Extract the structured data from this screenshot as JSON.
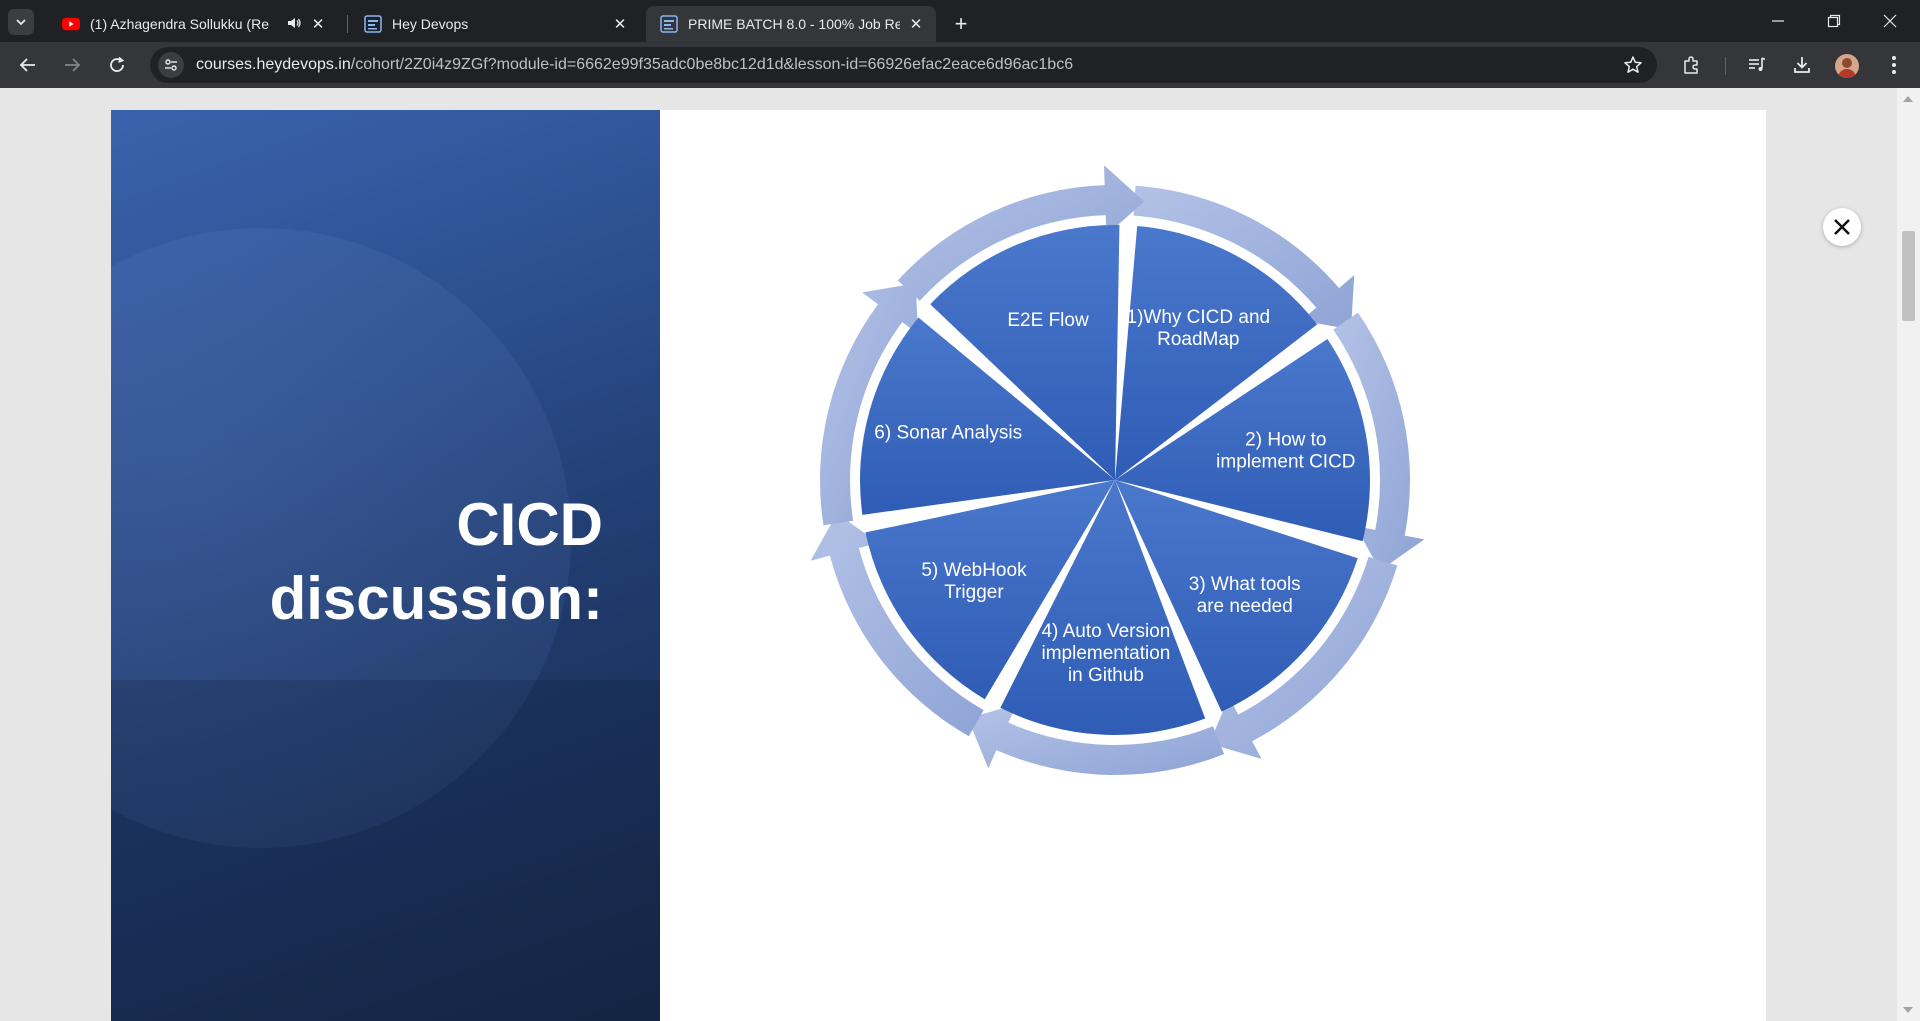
{
  "browser": {
    "tabs": [
      {
        "title": "(1) Azhagendra Sollukku (Re",
        "favicon": "youtube-icon",
        "audible": true,
        "active": false
      },
      {
        "title": "Hey Devops",
        "favicon": "heydevops-icon",
        "audible": false,
        "active": false
      },
      {
        "title": "PRIME BATCH 8.0 - 100% Job Re",
        "favicon": "heydevops-icon",
        "audible": false,
        "active": true
      }
    ],
    "new_tab_label": "+",
    "url": {
      "host": "courses.heydevops.in",
      "path": "/cohort/2Z0i4z9ZGf?module-id=6662e99f35adc0be8bc12d1d&lesson-id=66926efac2eace6d96ac1bc6"
    },
    "colors": {
      "frame": "#202124",
      "toolbar": "#35363a",
      "accent": "#e8eaed"
    }
  },
  "slide": {
    "title_lines": [
      "CICD",
      "discussion:"
    ],
    "segments": [
      {
        "lines": [
          "1)Why CICD and",
          "RoadMap"
        ]
      },
      {
        "lines": [
          "2) How to",
          "implement CICD"
        ]
      },
      {
        "lines": [
          "3) What tools",
          "are needed"
        ]
      },
      {
        "lines": [
          "4) Auto Version",
          "implementation",
          "in Github"
        ]
      },
      {
        "lines": [
          "5) WebHook",
          "Trigger"
        ]
      },
      {
        "lines": [
          "6) Sonar Analysis"
        ]
      },
      {
        "lines": [
          "E2E Flow"
        ]
      }
    ],
    "colors": {
      "segment": "#3f6cc4",
      "arrow": "#a8b8e0",
      "panel_dark": "#162848",
      "panel_light": "#3a63ad"
    }
  },
  "viewer": {
    "close_icon": "close-icon"
  }
}
